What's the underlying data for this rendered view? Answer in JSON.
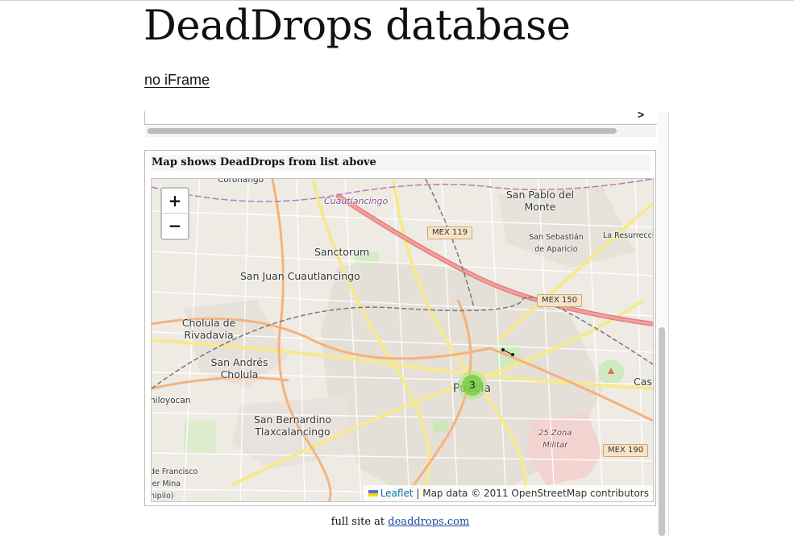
{
  "page": {
    "title": "DeadDrops database",
    "no_iframe_link": "no iFrame"
  },
  "list": {
    "arrow": ">"
  },
  "map": {
    "heading": "Map shows DeadDrops from list above",
    "zoom_in": "+",
    "zoom_out": "−",
    "cluster_count": "3",
    "attribution": {
      "leaflet": "Leaflet",
      "separator": " | ",
      "text": "Map data © 2011 OpenStreetMap contributors"
    },
    "labels": {
      "cuautlancingo": "Cuautlancingo",
      "san_pablo_line1": "San Pablo del",
      "san_pablo_line2": "Monte",
      "sanctorum": "Sanctorum",
      "san_juan": "San Juan Cuautlancingo",
      "san_sebastian_line1": "San Sebastián",
      "san_sebastian_line2": "de Aparicio",
      "la_resurreccion": "La Resurrecci",
      "cholula_rivadavia_line1": "Cholula de",
      "cholula_rivadavia_line2": "Rivadavia",
      "san_andres_line1": "San Andrés",
      "san_andres_line2": "Cholula",
      "puebla": "Puebla",
      "cas": "Cas",
      "hiloyocan": "hiloyocan",
      "san_bernardino_line1": "San Bernardino",
      "san_bernardino_line2": "Tlaxcalancingo",
      "zona_militar_line1": "25 Zona",
      "zona_militar_line2": "Militar",
      "san_francisco_line1": "de Francisco",
      "san_francisco_line2": "ier Mina",
      "san_francisco_line3": "hipilo)",
      "top_cut": "Coronango"
    },
    "shields": {
      "mex119": "MEX 119",
      "mex150": "MEX 150",
      "mex190": "MEX 190"
    }
  },
  "footer": {
    "prefix": "full site at ",
    "link": "deaddrops.com"
  }
}
